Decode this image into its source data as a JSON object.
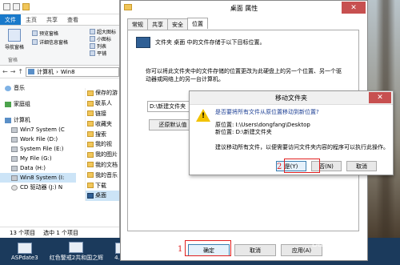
{
  "explorer": {
    "ribbon_tabs": [
      "文件",
      "主页",
      "共享",
      "查看"
    ],
    "nav_pane_label": "导航窗格",
    "preview_pane": "预览窗格",
    "details_pane": "详细信息窗格",
    "pane_group": "窗格",
    "view_big_icon": "超大图标",
    "view_small_icon": "小图标",
    "view_list": "列表",
    "view_tile": "平铺",
    "address": [
      "计算机",
      "Win8"
    ],
    "tree": [
      {
        "label": "音乐",
        "icon": "music-icon"
      },
      {
        "label": "家庭组",
        "icon": "homegroup-icon"
      },
      {
        "label": "计算机",
        "icon": "computer-icon"
      },
      {
        "label": "Win7 System (C",
        "icon": "drive-icon"
      },
      {
        "label": "Work File (D:)",
        "icon": "drive-icon"
      },
      {
        "label": "System File (E:)",
        "icon": "drive-icon"
      },
      {
        "label": "My File (G:)",
        "icon": "drive-icon"
      },
      {
        "label": "Data (H:)",
        "icon": "drive-icon"
      },
      {
        "label": "Win8 System (I:",
        "icon": "drive-icon"
      },
      {
        "label": "CD 驱动器 (J:) N",
        "icon": "cd-icon"
      }
    ],
    "files": [
      "保存的游",
      "联系人",
      "链接",
      "收藏夹",
      "搜索",
      "我的视",
      "我的图片",
      "我的文档",
      "我的音乐",
      "下载",
      "桌面"
    ],
    "status_count": "13 个项目",
    "status_selected": "选中 1 个项目"
  },
  "taskbar": {
    "items": [
      "ASPdate3",
      "红色警戒2共和国之辉",
      "4.png"
    ]
  },
  "props": {
    "title": "桌面 属性",
    "close": "✕",
    "tabs": [
      "常规",
      "共享",
      "安全",
      "位置"
    ],
    "location_label": "文件夹 桌面 中的文件存储于以下目标位置。",
    "description": "你可以将此文件夹中的文件存储的位置更改为此硬盘上的另一个位置、另一个驱动器或网络上的另一台计算机。",
    "path": "D:\\新建文件夹",
    "restore_button": "还原默认值",
    "buttons": {
      "ok": "确定",
      "cancel": "取消",
      "apply": "应用(A)"
    }
  },
  "move_dialog": {
    "title": "移动文件夹",
    "close": "✕",
    "question": "是否要将所有文件从原位置移动到新位置?",
    "original_label": "原位置:",
    "original_value": "I:\\Users\\dongfang\\Desktop",
    "new_label": "新位置:",
    "new_value": "D:\\新建文件夹",
    "note": "建议移动所有文件，以便需要访问文件夹内容的程序可以执行此操作。",
    "buttons": {
      "yes": "是(Y)",
      "no": "否(N)",
      "cancel": "取消"
    }
  },
  "annotations": {
    "step1": "1",
    "step2": "2"
  },
  "watermark": "Baidu 经验"
}
